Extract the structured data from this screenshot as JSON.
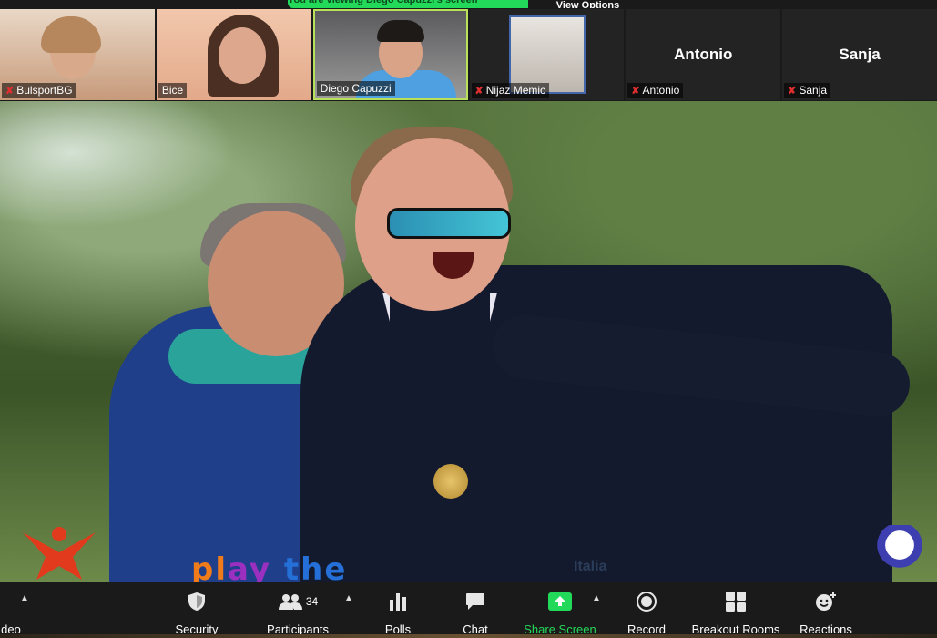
{
  "banner": {
    "message": "You are viewing Diego Capuzzi's screen",
    "options": "View Options"
  },
  "gallery": [
    {
      "name": "BulsportBG",
      "muted": true,
      "video": true
    },
    {
      "name": "Bice",
      "muted": false,
      "video": true
    },
    {
      "name": "Diego Capuzzi",
      "muted": false,
      "video": true,
      "active": true
    },
    {
      "name": "Nijaz Memic",
      "muted": true,
      "video": true
    },
    {
      "name": "Antonio",
      "muted": true,
      "video": false,
      "display_name": "Antonio"
    },
    {
      "name": "Sanja",
      "muted": true,
      "video": false,
      "display_name": "Sanja"
    }
  ],
  "shared_content": {
    "logo_text": [
      "pl",
      "ay",
      " the"
    ],
    "logo_secondary": "Italia"
  },
  "toolbar": {
    "video_label": "deo",
    "security_label": "Security",
    "participants_label": "Participants",
    "participants_count": "34",
    "polls_label": "Polls",
    "chat_label": "Chat",
    "share_label": "Share Screen",
    "record_label": "Record",
    "breakout_label": "Breakout Rooms",
    "reactions_label": "Reactions"
  },
  "colors": {
    "accent_green": "#23d959",
    "mute_red": "#e02f2f",
    "active_border": "#b9e05a",
    "toolbar_bg": "#1a1a1a"
  }
}
